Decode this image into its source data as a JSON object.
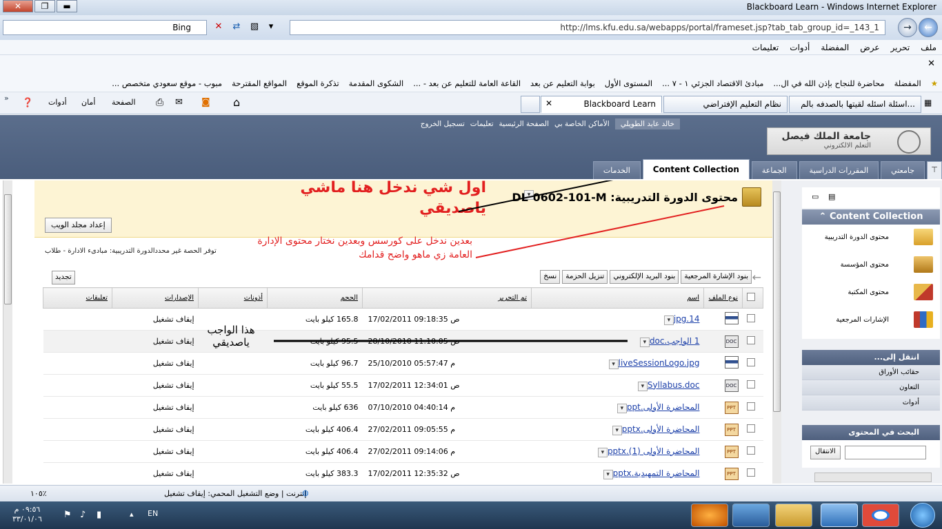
{
  "window": {
    "title": "Blackboard Learn - Windows Internet Explorer"
  },
  "addressbar": {
    "url": "http://lms.kfu.edu.sa/webapps/portal/frameset.jsp?tab_tab_group_id=_143_1",
    "search_provider": "Bing"
  },
  "menu": {
    "file": "ملف",
    "edit": "تحرير",
    "view": "عرض",
    "favorites": "المفضلة",
    "tools": "أدوات",
    "help": "تعليمات"
  },
  "favorites": {
    "label": "المفضلة",
    "items": [
      "محاضرة للنجاح بإذن الله في ال...",
      "مبادئ الاقتصاد الجزئي ١ - ٧ ...",
      "المستوى الأول",
      "بوابة التعليم عن بعد",
      "القاعة العامة للتعليم عن بعد - ...",
      "الشكوى المقدمة",
      "تذكرة الموقع",
      "المواقع المقترحة",
      "مبوب - موقع سعودي متخصص ..."
    ]
  },
  "commandbar": {
    "page": "الصفحة",
    "safety": "أمان",
    "tools": "أدوات"
  },
  "ietabs": [
    "اسئلة اسئله لقيتها بالصدفه بالم...",
    "نظام التعليم الإفتراضي",
    "Blackboard Learn"
  ],
  "bb": {
    "toplinks": {
      "user": "خالد عايد الطويلي",
      "myplaces": "الأماكن الخاصة بي",
      "home": "الصفحة الرئيسية",
      "help": "تعليمات",
      "logout": "تسجيل الخروج"
    },
    "logo": {
      "line1": "جامعة الملك فيصل",
      "line2": "التعلم الالكتروني"
    },
    "tabs": [
      "جامعتي",
      "المقررات الدراسية",
      "الجماعة",
      "Content Collection",
      "الخدمات"
    ]
  },
  "page": {
    "title": "محتوى الدورة التدريبية: DL-0602-101-M",
    "web_folder_button": "إعداد مجلد الويب",
    "course_label": "توفر الحصة  غير محددالدورة التدريبية:  مبادىء الادارة - طلاب",
    "toolbar": [
      "بنود الإشارة المرجعية",
      "بنود البريد الإلكتروني",
      "تنزيل الحزمة",
      "نسخ"
    ],
    "refresh": "تجديد",
    "columns": [
      "نوع الملف",
      "اسم",
      "تم التحرير",
      "الحجم",
      "أذونات",
      "الإصدارات",
      "تعليقات"
    ],
    "rows": [
      {
        "name": "jpg.14",
        "edited": "17/02/2011 09:18:35 ص",
        "size": "165.8 كيلو بايت",
        "lock": "إيقاف تشغيل",
        "type": "img"
      },
      {
        "name": "1 الواجب.doc",
        "edited": "28/10/2010 11:10:05 ص",
        "size": "95.5 كيلو بايت",
        "lock": "إيقاف تشغيل",
        "type": "doc"
      },
      {
        "name": "liveSessionLogo.jpg",
        "edited": "25/10/2010 05:57:47 م",
        "size": "96.7 كيلو بايت",
        "lock": "إيقاف تشغيل",
        "type": "img"
      },
      {
        "name": "Syllabus.doc",
        "edited": "17/02/2011 12:34:01 ص",
        "size": "55.5 كيلو بايت",
        "lock": "إيقاف تشغيل",
        "type": "doc"
      },
      {
        "name": "المحاضرة الأولى.ppt",
        "edited": "07/10/2010 04:40:14 م",
        "size": "636 كيلو بايت",
        "lock": "إيقاف تشغيل",
        "type": "ppt"
      },
      {
        "name": "المحاضرة الأولى.pptx",
        "edited": "27/02/2011 09:05:55 م",
        "size": "406.4 كيلو بايت",
        "lock": "إيقاف تشغيل",
        "type": "ppt"
      },
      {
        "name": "المحاضرة الأولى (1).pptx",
        "edited": "27/02/2011 09:14:06 م",
        "size": "406.4 كيلو بايت",
        "lock": "إيقاف تشغيل",
        "type": "ppt"
      },
      {
        "name": "المحاضرة التمهيدية.pptx",
        "edited": "17/02/2011 12:35:32 ص",
        "size": "383.3 كيلو بايت",
        "lock": "إيقاف تشغيل",
        "type": "ppt"
      }
    ]
  },
  "annotations": {
    "a1": "اول شي ندخل هنا ماشي ياصديقي",
    "a2": "بعدين ندخل على كورسس وبعدين نختار محتوى الإدارة  العامة زي ماهو واضح قدامك",
    "a3": "هذا الواجب ياصديقي"
  },
  "sidebar": {
    "cc_title": "Content Collection",
    "cc_items": [
      "محتوى الدورة التدريبية",
      "محتوى المؤسسة",
      "محتوى المكتبة",
      "الإشارات المرجعية"
    ],
    "goto_title": "انتقل إلى...",
    "goto_items": [
      "حقائب الأوراق",
      "التعاون",
      "أدوات"
    ],
    "search_title": "البحث في المحتوى",
    "search_go": "الانتقال"
  },
  "statusbar": {
    "text": "إنترنت | وضع التشغيل المحمي: إيقاف تشغيل",
    "zoom": "١٠٥٪"
  },
  "taskbar": {
    "time": "٠٩:٥٦ م",
    "date": "٣٣/٠١/٠٦",
    "lang": "EN"
  },
  "colors": {
    "bb_header": "#4a5d7c",
    "annotation": "#e22020",
    "page_header_bg": "#fdf4d4",
    "link": "#1a3ea8"
  }
}
